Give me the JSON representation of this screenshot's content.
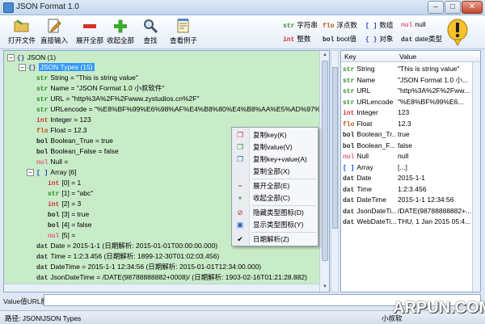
{
  "window": {
    "title": "JSON Format 1.0",
    "min": "–",
    "max": "□",
    "close": "✕"
  },
  "toolbar": {
    "open": "打开文件",
    "input": "直接输入",
    "expand": "展开全部",
    "collapse": "收起全部",
    "search": "查找",
    "example": "查看例子"
  },
  "legend": [
    {
      "tag": "str",
      "label": "字符串",
      "color": "#2a8a2a"
    },
    {
      "tag": "flo",
      "label": "浮点数",
      "color": "#c05010"
    },
    {
      "tag": "[ ]",
      "label": "数组",
      "color": "#1d3fc0"
    },
    {
      "tag": "nul",
      "label": "null",
      "color": "#e06080"
    },
    {
      "tag": "int",
      "label": "整数",
      "color": "#d03030"
    },
    {
      "tag": "bol",
      "label": "bool值",
      "color": "#222222"
    },
    {
      "tag": "{ }",
      "label": "对象",
      "color": "#5a3ab0"
    },
    {
      "tag": "dat",
      "label": "date类型",
      "color": "#333333"
    }
  ],
  "tree": {
    "root": "JSON (1)",
    "types": "JSON Types (15)",
    "nodes": [
      {
        "tag": "str",
        "text": "String = \"This is string value\""
      },
      {
        "tag": "str",
        "text": "Name = \"JSON Format 1.0 小叔软件\""
      },
      {
        "tag": "str",
        "text": "URL = \"http%3A%2F%2Fwww.zystudios.cn%2F\""
      },
      {
        "tag": "str",
        "text": "URLencode = \"%E8%BF%99%E6%98%AF%E4%B8%80%E4%B8%AA%E5%AD%97%E7%AC"
      },
      {
        "tag": "int",
        "text": "Integer = 123"
      },
      {
        "tag": "flo",
        "text": "Float = 12.3"
      },
      {
        "tag": "bol",
        "text": "Boolean_True = true"
      },
      {
        "tag": "bol",
        "text": "Boolean_False = false"
      },
      {
        "tag": "nul",
        "text": "Null ="
      }
    ],
    "array_label": "Array [6]",
    "array": [
      {
        "tag": "int",
        "text": "[0] = 1"
      },
      {
        "tag": "str",
        "text": "[1] = \"abc\""
      },
      {
        "tag": "int",
        "text": "[2] = 3"
      },
      {
        "tag": "bol",
        "text": "[3] = true"
      },
      {
        "tag": "bol",
        "text": "[4] = false"
      },
      {
        "tag": "nul",
        "text": "[5] ="
      }
    ],
    "dates": [
      {
        "tag": "dat",
        "text": "Date = 2015-1-1 (日期解析: 2015-01-01T00:00:00.000)"
      },
      {
        "tag": "dat",
        "text": "Time = 1:2:3.456 (日期解析: 1899-12-30T01:02:03.456)"
      },
      {
        "tag": "dat",
        "text": "DateTime = 2015-1-1 12:34:56 (日期解析: 2015-01-01T12:34:00.000)"
      },
      {
        "tag": "dat",
        "text": "JsonDateTime = /DATE(98788888882+0008)/ (日期解析: 1903-02-16T01:21:28.882)"
      }
    ]
  },
  "context_menu": {
    "copy_key": "复制key(K)",
    "copy_value": "复制value(V)",
    "copy_kv": "复制key+value(A)",
    "copy_all": "复制全部(X)",
    "expand_all": "展开全部(E)",
    "collapse_all": "收起全部(C)",
    "hide_icons": "隐藏类型图标(D)",
    "show_icons": "显示类型图标(Y)",
    "date_parse": "日期解析(Z)"
  },
  "grid": {
    "key_header": "Key",
    "value_header": "Value",
    "rows": [
      {
        "tag": "str",
        "key": "String",
        "value": "\"This is string value\""
      },
      {
        "tag": "str",
        "key": "Name",
        "value": "\"JSON Format 1.0 小..."
      },
      {
        "tag": "str",
        "key": "URL",
        "value": "\"http%3A%2F%2Fww..."
      },
      {
        "tag": "str",
        "key": "URLencode",
        "value": "\"%E8%BF%99%E6..."
      },
      {
        "tag": "int",
        "key": "Integer",
        "value": "123"
      },
      {
        "tag": "flo",
        "key": "Float",
        "value": "12.3"
      },
      {
        "tag": "bol",
        "key": "Boolean_Tr...",
        "value": "true"
      },
      {
        "tag": "bol",
        "key": "Boolean_F...",
        "value": "false"
      },
      {
        "tag": "nul",
        "key": "Null",
        "value": "null"
      },
      {
        "tag": "[ ]",
        "key": "Array",
        "value": "[...]"
      },
      {
        "tag": "dat",
        "key": "Date",
        "value": "2015-1-1"
      },
      {
        "tag": "dat",
        "key": "Time",
        "value": "1:2:3.456"
      },
      {
        "tag": "dat",
        "key": "DateTime",
        "value": "2015-1-1 12:34:56"
      },
      {
        "tag": "dat",
        "key": "JsonDateTi...",
        "value": "/DATE(98788888882+..."
      },
      {
        "tag": "dat",
        "key": "WebDateTi...",
        "value": "THU, 1 Jan 2015 05:4..."
      }
    ]
  },
  "bottom": {
    "label": "Value值URL解码"
  },
  "status": {
    "path": "路径: JSON\\JSON Types",
    "right": "小叔软"
  },
  "watermark": "ARPUN.COM"
}
